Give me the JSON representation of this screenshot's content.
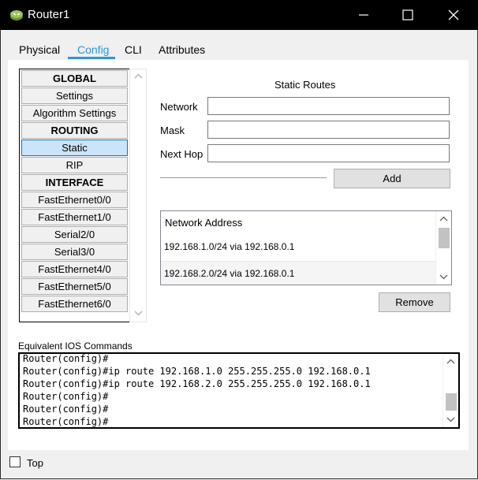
{
  "window": {
    "title": "Router1",
    "icons": {
      "app": "router-app-icon",
      "minimize": "minimize-icon",
      "maximize": "maximize-icon",
      "close": "close-icon"
    }
  },
  "tabs": [
    {
      "label": "Physical",
      "active": false
    },
    {
      "label": "Config",
      "active": true
    },
    {
      "label": "CLI",
      "active": false
    },
    {
      "label": "Attributes",
      "active": false
    }
  ],
  "nav": {
    "items": [
      {
        "label": "GLOBAL",
        "header": true
      },
      {
        "label": "Settings"
      },
      {
        "label": "Algorithm Settings"
      },
      {
        "label": "ROUTING",
        "header": true
      },
      {
        "label": "Static",
        "selected": true
      },
      {
        "label": "RIP"
      },
      {
        "label": "INTERFACE",
        "header": true
      },
      {
        "label": "FastEthernet0/0"
      },
      {
        "label": "FastEthernet1/0"
      },
      {
        "label": "Serial2/0"
      },
      {
        "label": "Serial3/0"
      },
      {
        "label": "FastEthernet4/0"
      },
      {
        "label": "FastEthernet5/0"
      },
      {
        "label": "FastEthernet6/0"
      }
    ]
  },
  "static_routes": {
    "title": "Static Routes",
    "network_label": "Network",
    "network_value": "",
    "mask_label": "Mask",
    "mask_value": "",
    "next_hop_label": "Next Hop",
    "next_hop_value": "",
    "add_label": "Add",
    "list_header": "Network Address",
    "routes": [
      "192.168.1.0/24 via 192.168.0.1",
      "192.168.2.0/24 via 192.168.0.1"
    ],
    "remove_label": "Remove"
  },
  "ios": {
    "label": "Equivalent IOS Commands",
    "lines": [
      "Router(config)#",
      "Router(config)#ip route 192.168.1.0 255.255.255.0 192.168.0.1",
      "Router(config)#ip route 192.168.2.0 255.255.255.0 192.168.0.1",
      "Router(config)#",
      "Router(config)#",
      "Router(config)#"
    ]
  },
  "footer": {
    "top_label": "Top",
    "top_checked": false
  },
  "colors": {
    "accent": "#2f95d6",
    "selected_bg": "#cce4f7",
    "titlebar": "#000000"
  }
}
